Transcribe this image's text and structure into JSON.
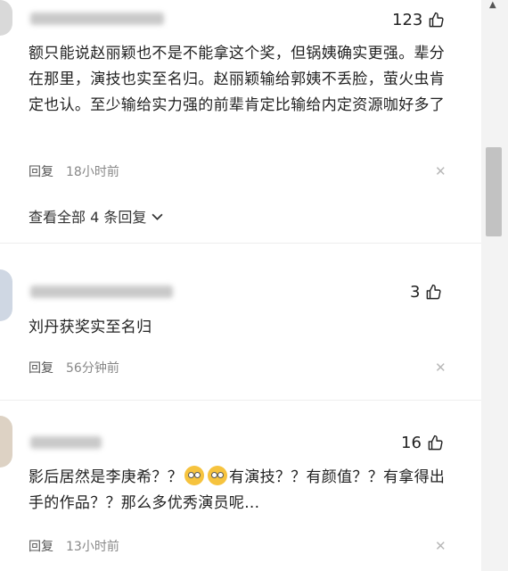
{
  "comments": [
    {
      "likes": "123",
      "text": "额只能说赵丽颖也不是不能拿这个奖，但锅姨确实更强。辈分在那里，演技也实至名归。赵丽颖输给郭姨不丢脸，萤火虫肯定也认。至少输给实力强的前辈肯定比输给内定资源咖好多了",
      "reply_label": "回复",
      "time": "18小时前",
      "view_all": "查看全部 4 条回复"
    },
    {
      "likes": "3",
      "text": "刘丹获奖实至名归",
      "reply_label": "回复",
      "time": "56分钟前"
    },
    {
      "likes": "16",
      "text_part1": "影后居然是李庚希？？",
      "text_part2": "有演技？？有颜值？？有拿得出手的作品？？那么多优秀演员呢...",
      "reply_label": "回复",
      "time": "13小时前"
    }
  ],
  "icons": {
    "thumb": "thumbs-up-icon",
    "close": "close-icon",
    "chevron": "chevron-down-icon",
    "emoji": "flushed-face-emoji"
  }
}
